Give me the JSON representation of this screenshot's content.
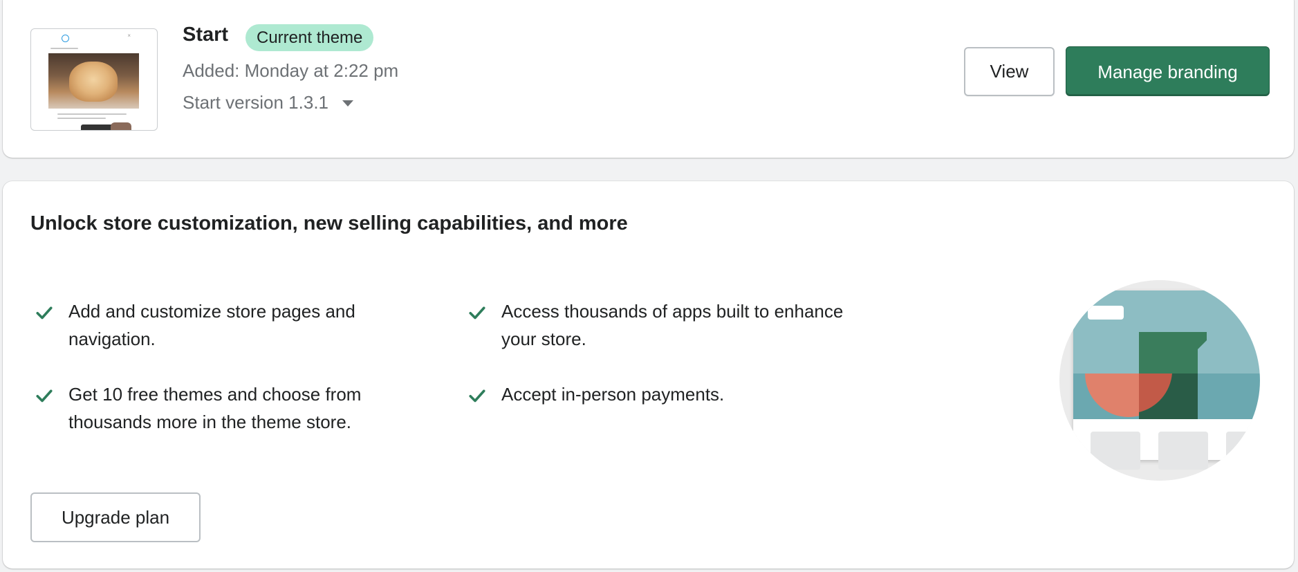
{
  "theme_card": {
    "title": "Start",
    "badge": "Current theme",
    "added": "Added: Monday at 2:22 pm",
    "version": "Start version 1.3.1",
    "buttons": {
      "view": "View",
      "manage_branding": "Manage branding"
    }
  },
  "upsell_card": {
    "title": "Unlock store customization, new selling capabilities, and more",
    "features": [
      "Add and customize store pages and navigation.",
      "Access thousands of apps built to enhance your store.",
      "Get 10 free themes and choose from thousands more in the theme store.",
      "Accept in-person payments."
    ],
    "upgrade_button": "Upgrade plan"
  },
  "icons": {
    "checkmark": "check-icon",
    "dropdown": "caret-down-icon"
  },
  "colors": {
    "primary": "#2e7d5b",
    "badge_bg": "#aee9d1",
    "check": "#2e7d5b",
    "muted_text": "#6d7175"
  }
}
